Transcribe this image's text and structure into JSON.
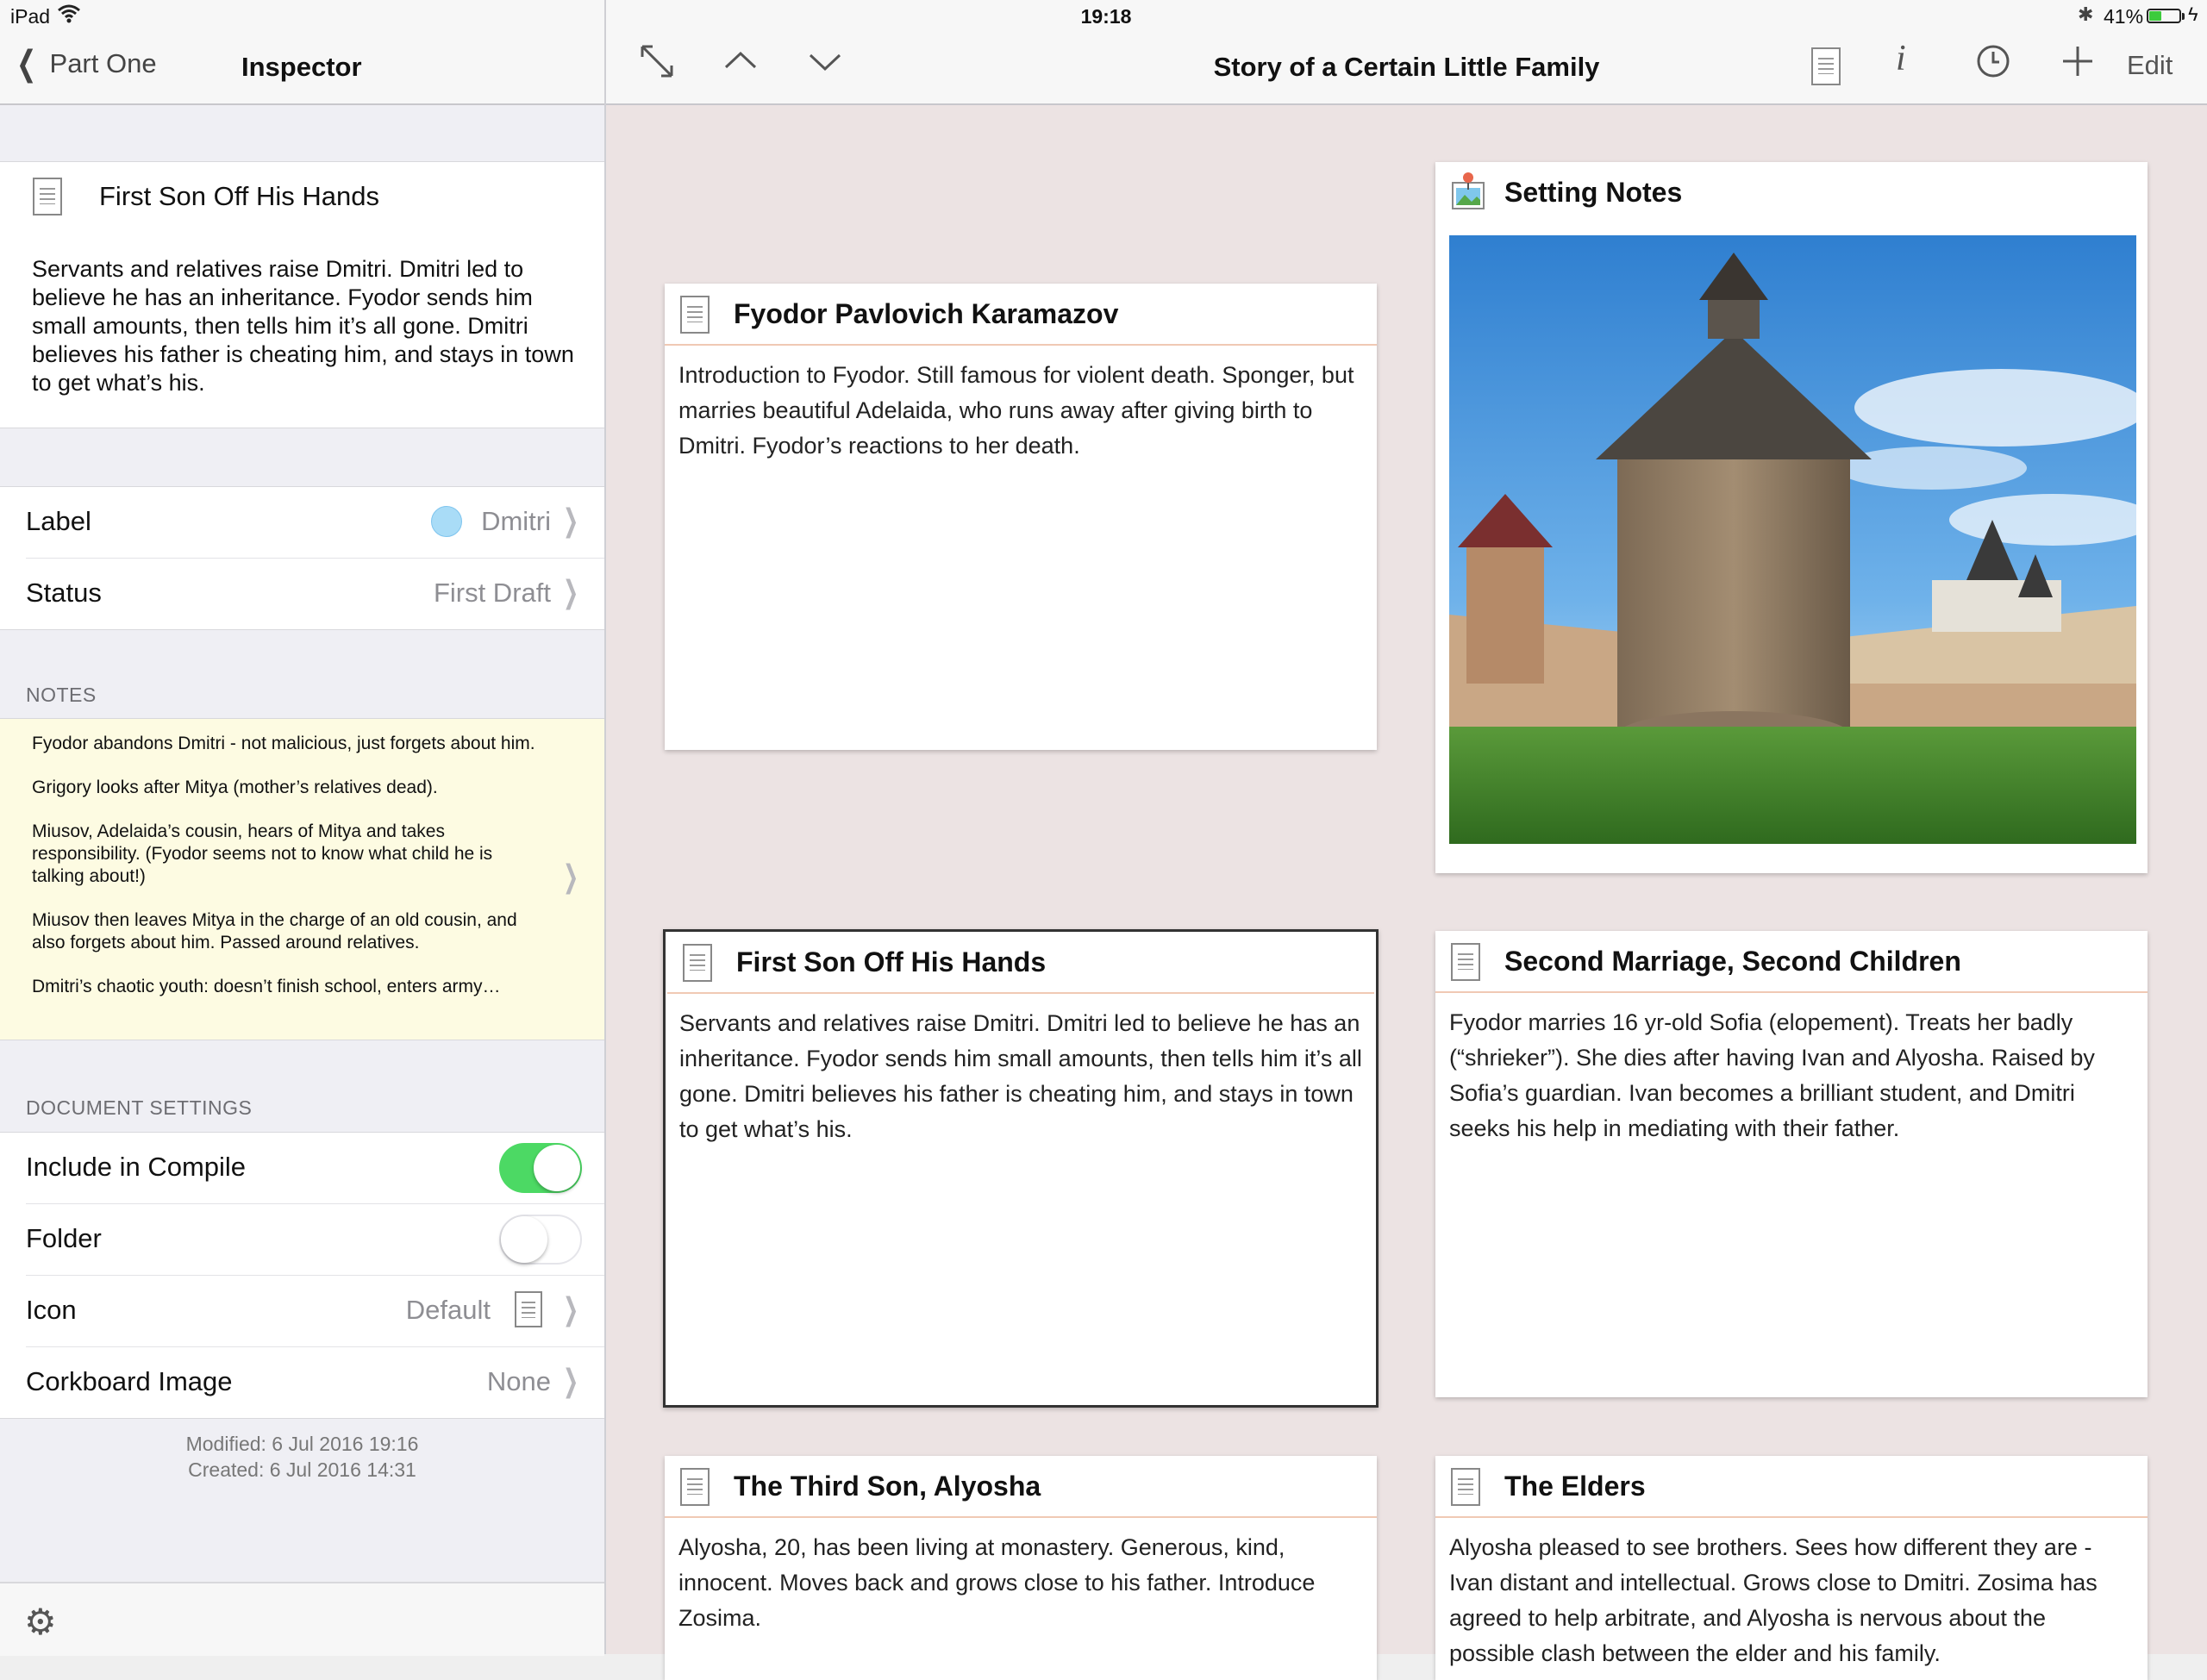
{
  "status_bar": {
    "device": "iPad",
    "time": "19:18",
    "battery": "41%",
    "battery_level": 0.41
  },
  "inspector": {
    "back_label": "Part One",
    "title": "Inspector",
    "doc_title": "First Son Off His Hands",
    "synopsis": "Servants and relatives raise Dmitri. Dmitri led to believe he has an inheritance. Fyodor sends him small amounts, then tells him it’s all gone. Dmitri believes his father is cheating him, and stays in town to get what’s his.",
    "label_key": "Label",
    "label_value": "Dmitri",
    "label_color": "#a9dcf7",
    "status_key": "Status",
    "status_value": "First Draft",
    "notes_caption": "NOTES",
    "notes": [
      "Fyodor abandons Dmitri - not malicious, just forgets about him.",
      "Grigory looks after Mitya (mother’s relatives dead).",
      "Miusov, Adelaida’s cousin, hears of Mitya and takes responsibility. (Fyodor seems not to know what child he is talking about!)",
      "Miusov then leaves Mitya in the charge of an old cousin, and also forgets about him. Passed around relatives.",
      "Dmitri’s chaotic youth: doesn’t finish school, enters army…"
    ],
    "doc_settings_caption": "DOCUMENT SETTINGS",
    "include_compile_label": "Include in Compile",
    "include_compile_on": true,
    "folder_label": "Folder",
    "folder_on": false,
    "icon_label": "Icon",
    "icon_value": "Default",
    "corkboard_image_label": "Corkboard Image",
    "corkboard_image_value": "None",
    "modified": "Modified: 6 Jul 2016  19:16",
    "created": "Created: 6 Jul 2016  14:31"
  },
  "main": {
    "title": "Story of a Certain Little Family",
    "edit_label": "Edit",
    "accent_green": "#4cd964"
  },
  "cards": [
    {
      "title": "Fyodor Pavlovich  Karamazov",
      "body": "Introduction to Fyodor. Still famous for violent death. Sponger, but marries beautiful Adelaida, who runs away after giving birth to Dmitri. Fyodor’s reactions to her death."
    },
    {
      "title": "Setting Notes",
      "body": ""
    },
    {
      "title": "First Son Off His Hands",
      "body": "Servants and relatives raise Dmitri. Dmitri led to believe he has an inheritance. Fyodor sends him small amounts, then tells him it’s all gone. Dmitri believes his father is cheating him, and stays in town to get what’s his."
    },
    {
      "title": "Second Marriage, Second Children",
      "body": "Fyodor marries 16 yr-old Sofia (elopement). Treats her badly (“shrieker”). She dies after having Ivan and Alyosha. Raised by Sofia’s guardian. Ivan becomes a brilliant student, and Dmitri seeks his help in mediating with their father."
    },
    {
      "title": "The Third Son, Alyosha",
      "body": "Alyosha, 20, has been living at monastery. Generous, kind, innocent. Moves back and grows close to his father. Introduce Zosima."
    },
    {
      "title": "The Elders",
      "body": "Alyosha pleased to see brothers. Sees how different they are - Ivan distant and intellectual. Grows close to Dmitri. Zosima has agreed to help arbitrate, and Alyosha is nervous about the possible clash between the elder and his family."
    }
  ]
}
